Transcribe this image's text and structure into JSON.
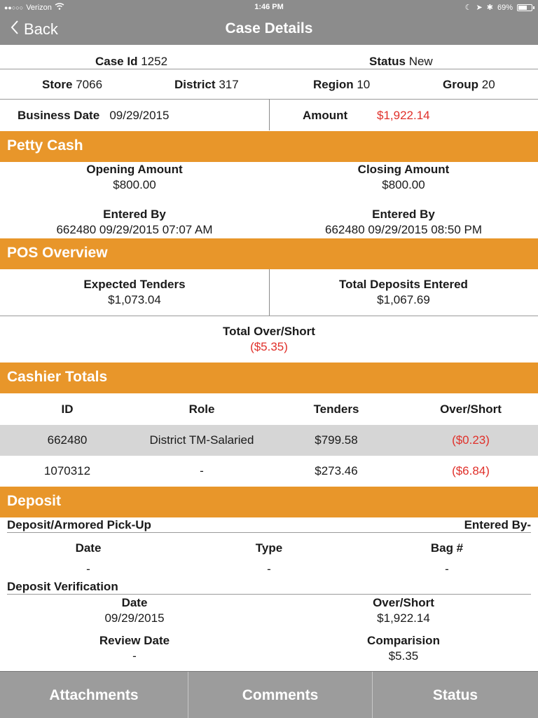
{
  "status_bar": {
    "carrier": "Verizon",
    "time": "1:46 PM",
    "battery": "69%",
    "battery_level": 0.69
  },
  "nav": {
    "back_label": "Back",
    "title": "Case Details"
  },
  "case": {
    "case_id_label": "Case Id",
    "case_id": "1252",
    "status_label": "Status",
    "status": "New",
    "store_label": "Store",
    "store": "7066",
    "district_label": "District",
    "district": "317",
    "region_label": "Region",
    "region": "10",
    "group_label": "Group",
    "group": "20",
    "business_date_label": "Business Date",
    "business_date": "09/29/2015",
    "amount_label": "Amount",
    "amount": "$1,922.14"
  },
  "petty_cash": {
    "header": "Petty Cash",
    "opening_label": "Opening Amount",
    "opening_value": "$800.00",
    "closing_label": "Closing Amount",
    "closing_value": "$800.00",
    "entered_by_label_left": "Entered By",
    "entered_by_left": "662480 09/29/2015 07:07 AM",
    "entered_by_label_right": "Entered By",
    "entered_by_right": "662480 09/29/2015 08:50 PM"
  },
  "pos_overview": {
    "header": "POS Overview",
    "expected_label": "Expected Tenders",
    "expected_value": "$1,073.04",
    "deposits_label": "Total Deposits Entered",
    "deposits_value": "$1,067.69",
    "over_short_label": "Total Over/Short",
    "over_short_value": "($5.35)"
  },
  "cashier_totals": {
    "header": "Cashier Totals",
    "columns": [
      "ID",
      "Role",
      "Tenders",
      "Over/Short"
    ],
    "rows": [
      {
        "id": "662480",
        "role": "District TM-Salaried",
        "tenders": "$799.58",
        "over_short": "($0.23)"
      },
      {
        "id": "1070312",
        "role": "-",
        "tenders": "$273.46",
        "over_short": "($6.84)"
      }
    ]
  },
  "deposit": {
    "header": "Deposit",
    "pickup_label": "Deposit/Armored Pick-Up",
    "entered_by_label": "Entered By-",
    "date_label": "Date",
    "type_label": "Type",
    "bag_label": "Bag #",
    "date_value": "-",
    "type_value": "-",
    "bag_value": "-",
    "verification_label": "Deposit Verification",
    "v_date_label": "Date",
    "v_date_value": "09/29/2015",
    "v_over_short_label": "Over/Short",
    "v_over_short_value": "$1,922.14",
    "review_date_label": "Review Date",
    "review_date_value": "-",
    "comparision_label": "Comparision",
    "comparision_value": "$5.35"
  },
  "tabs": {
    "attachments": "Attachments",
    "comments": "Comments",
    "status": "Status"
  },
  "colors": {
    "section_orange": "#e8962a",
    "nav_gray": "#8c8c8c",
    "negative_red": "#e0302a"
  }
}
